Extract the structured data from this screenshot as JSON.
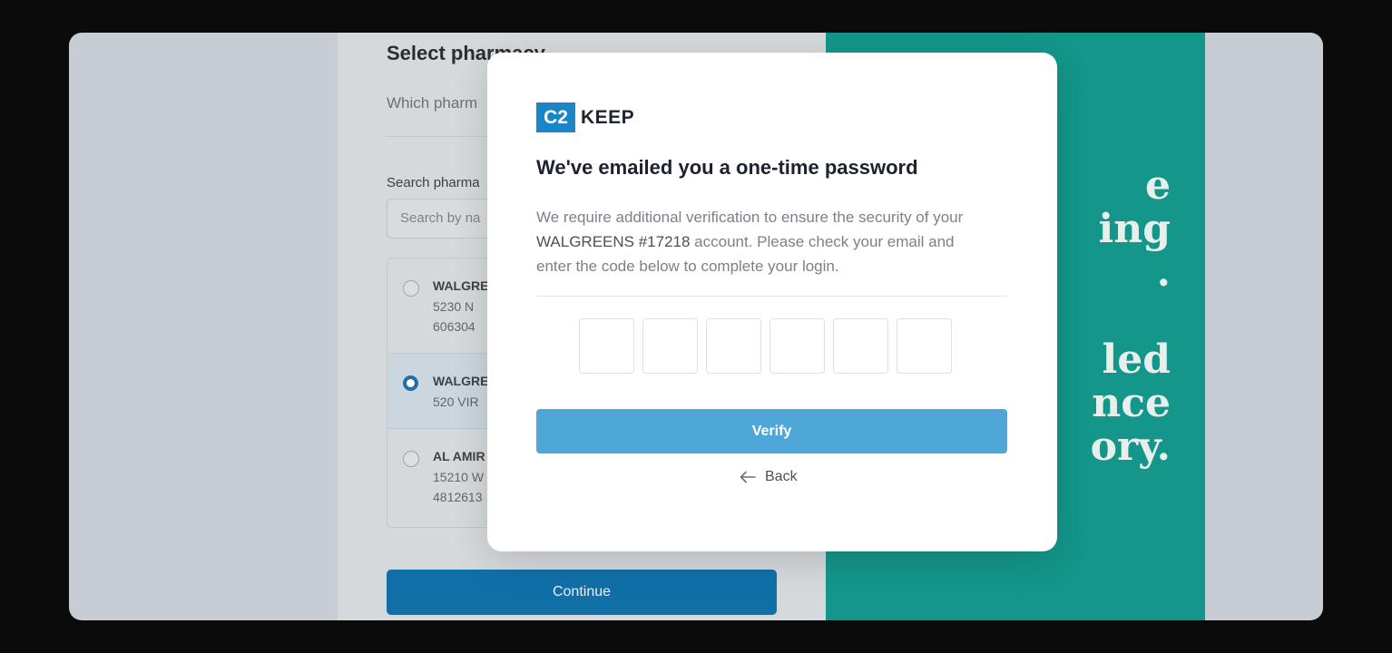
{
  "background": {
    "title": "Select pharmacy",
    "subtitle": "Which pharm",
    "search_label": "Search pharma",
    "search_placeholder": "Search by na",
    "items": [
      {
        "name": "WALGRE",
        "line1": "5230 N",
        "line2": "606304",
        "selected": false
      },
      {
        "name": "WALGRE",
        "line1": "520 VIR",
        "line2": "",
        "selected": true
      },
      {
        "name": "AL AMIR",
        "line1": "15210 W",
        "line2": "4812613",
        "selected": false
      }
    ],
    "continue_label": "Continue",
    "side_text": "e\ning\n.\n\nled\nnce\nory."
  },
  "modal": {
    "logo_box": "C2",
    "logo_word": "KEEP",
    "title": "We've emailed you a one-time password",
    "desc_before": "We require additional verification to ensure the security of your ",
    "desc_account": "WALGREENS #17218",
    "desc_after": " account. Please check your email and enter the code below to complete your login.",
    "otp_digits": [
      "",
      "",
      "",
      "",
      "",
      ""
    ],
    "verify_label": "Verify",
    "back_label": "Back"
  },
  "colors": {
    "brand": "#1a86c8",
    "verify": "#4fa7d8",
    "teal": "#14968a",
    "continue": "#116fa8"
  }
}
